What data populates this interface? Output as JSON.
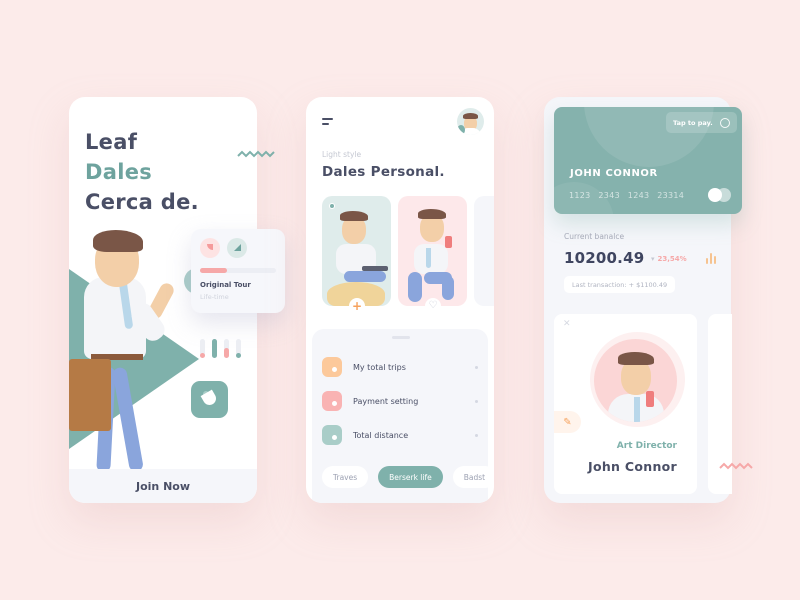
{
  "colors": {
    "background": "#fcebea",
    "teal": "#7fb1ab",
    "teal_text": "#6ea39e",
    "dark_text": "#4a4f66",
    "pink": "#f6a8a8",
    "orange": "#f6a25d",
    "panel": "#f5f6fa"
  },
  "onboarding": {
    "title_line1": "Leaf",
    "title_line2": "Dales",
    "title_line3": "Cerca de.",
    "tour_card": {
      "title": "Original Tour",
      "subtitle": "Life-time",
      "progress": 0.35,
      "icons": [
        "pink-shape-icon",
        "teal-shape-icon"
      ]
    },
    "sliders": [
      {
        "color": "#f6a8a8",
        "level": 0.25
      },
      {
        "color": "#7fb1ab",
        "level": 1.0
      },
      {
        "color": "#f6a8a8",
        "level": 0.55
      },
      {
        "color": "#7fb1ab",
        "level": 0.25
      }
    ],
    "app_tile_icon": "pie-icon",
    "cta_label": "Join Now"
  },
  "personal": {
    "menu_icon": "menu-icon",
    "eyebrow": "Light style",
    "title": "Dales Personal.",
    "cards": [
      {
        "action_icon": "plus-icon",
        "action_glyph": "+"
      },
      {
        "action_icon": "heart-icon",
        "action_glyph": "♡"
      }
    ],
    "menu_items": [
      {
        "label": "My total trips",
        "color": "#fcc99b"
      },
      {
        "label": "Payment setting",
        "color": "#f9b3b3"
      },
      {
        "label": "Total distance",
        "color": "#a9cdc8"
      }
    ],
    "chips": [
      {
        "label": "Traves",
        "active": false
      },
      {
        "label": "Berserk life",
        "active": true
      },
      {
        "label": "Badst",
        "active": false
      }
    ]
  },
  "wallet": {
    "card": {
      "tap_label": "Tap to pay.",
      "holder": "JOHN CONNOR",
      "number": "1123 2343 1243 23314"
    },
    "balance_label": "Current banalce",
    "balance_value": "10200.49",
    "delta_arrow": "▾",
    "delta": "23,54%",
    "last_transaction": "Last transaction: + $1100.49",
    "profile": {
      "close_glyph": "✕",
      "edit_glyph": "✎",
      "role": "Art Director",
      "name": "John Connor"
    }
  }
}
